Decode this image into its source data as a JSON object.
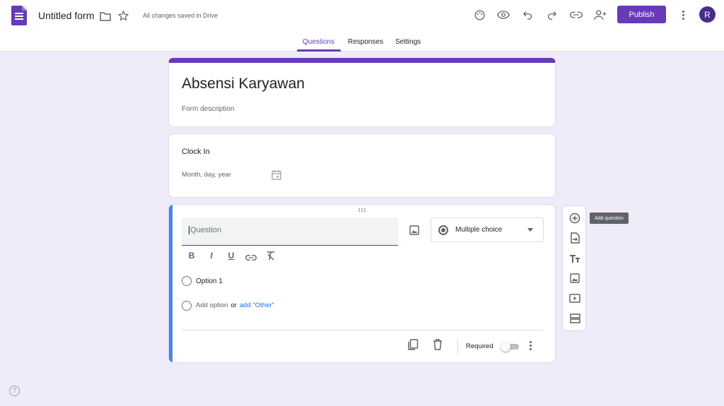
{
  "header": {
    "title": "Untitled form",
    "saved_status": "All changes saved in Drive",
    "publish_label": "Publish",
    "avatar_initial": "R",
    "icons": [
      "palette-icon",
      "preview-eye-icon",
      "undo-icon",
      "redo-icon",
      "link-icon",
      "add-collaborator-icon"
    ]
  },
  "tabs": [
    {
      "label": "Questions",
      "active": true
    },
    {
      "label": "Responses",
      "active": false
    },
    {
      "label": "Settings",
      "active": false
    }
  ],
  "form": {
    "title": "Absensi Karyawan",
    "description_placeholder": "Form description"
  },
  "clock_in": {
    "question": "Clock In",
    "date_placeholder": "Month, day, year"
  },
  "editor": {
    "question_placeholder": "Question",
    "question_type": "Multiple choice",
    "format_buttons": [
      "B",
      "I",
      "U"
    ],
    "option1": "Option 1",
    "add_option": "Add option",
    "or": "or",
    "add_other": "add \"Other\"",
    "required_label": "Required",
    "required": false
  },
  "sidebar": {
    "tooltip": "Add question",
    "items": [
      "add-question-icon",
      "import-questions-icon",
      "add-title-icon",
      "add-image-icon",
      "add-video-icon",
      "add-section-icon"
    ]
  },
  "help": "?",
  "colors": {
    "accent": "#673ab7",
    "background": "#efebf9",
    "active_bar": "#4285f4",
    "link": "#1a73e8"
  }
}
